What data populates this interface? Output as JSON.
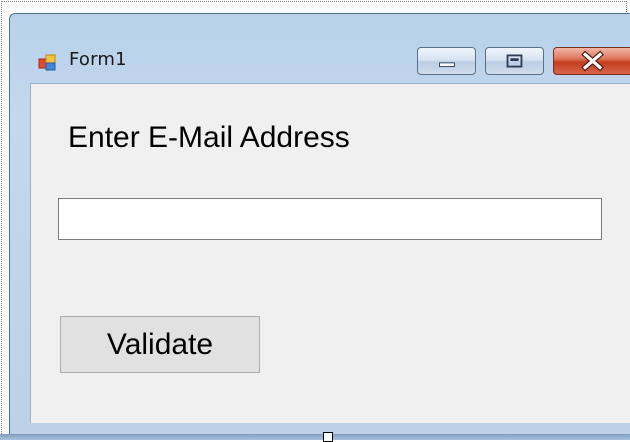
{
  "window": {
    "title": "Form1",
    "icon": "form-app-icon",
    "controls": [
      "minimize-icon",
      "maximize-icon",
      "close-icon"
    ]
  },
  "form": {
    "label": "Enter E-Mail Address",
    "email_input": {
      "value": "",
      "placeholder": ""
    },
    "validate_label": "Validate"
  },
  "colors": {
    "client_background": "#f0f0f0",
    "titlebar": "#b9d1ea",
    "close_button": "#c43d1f"
  }
}
